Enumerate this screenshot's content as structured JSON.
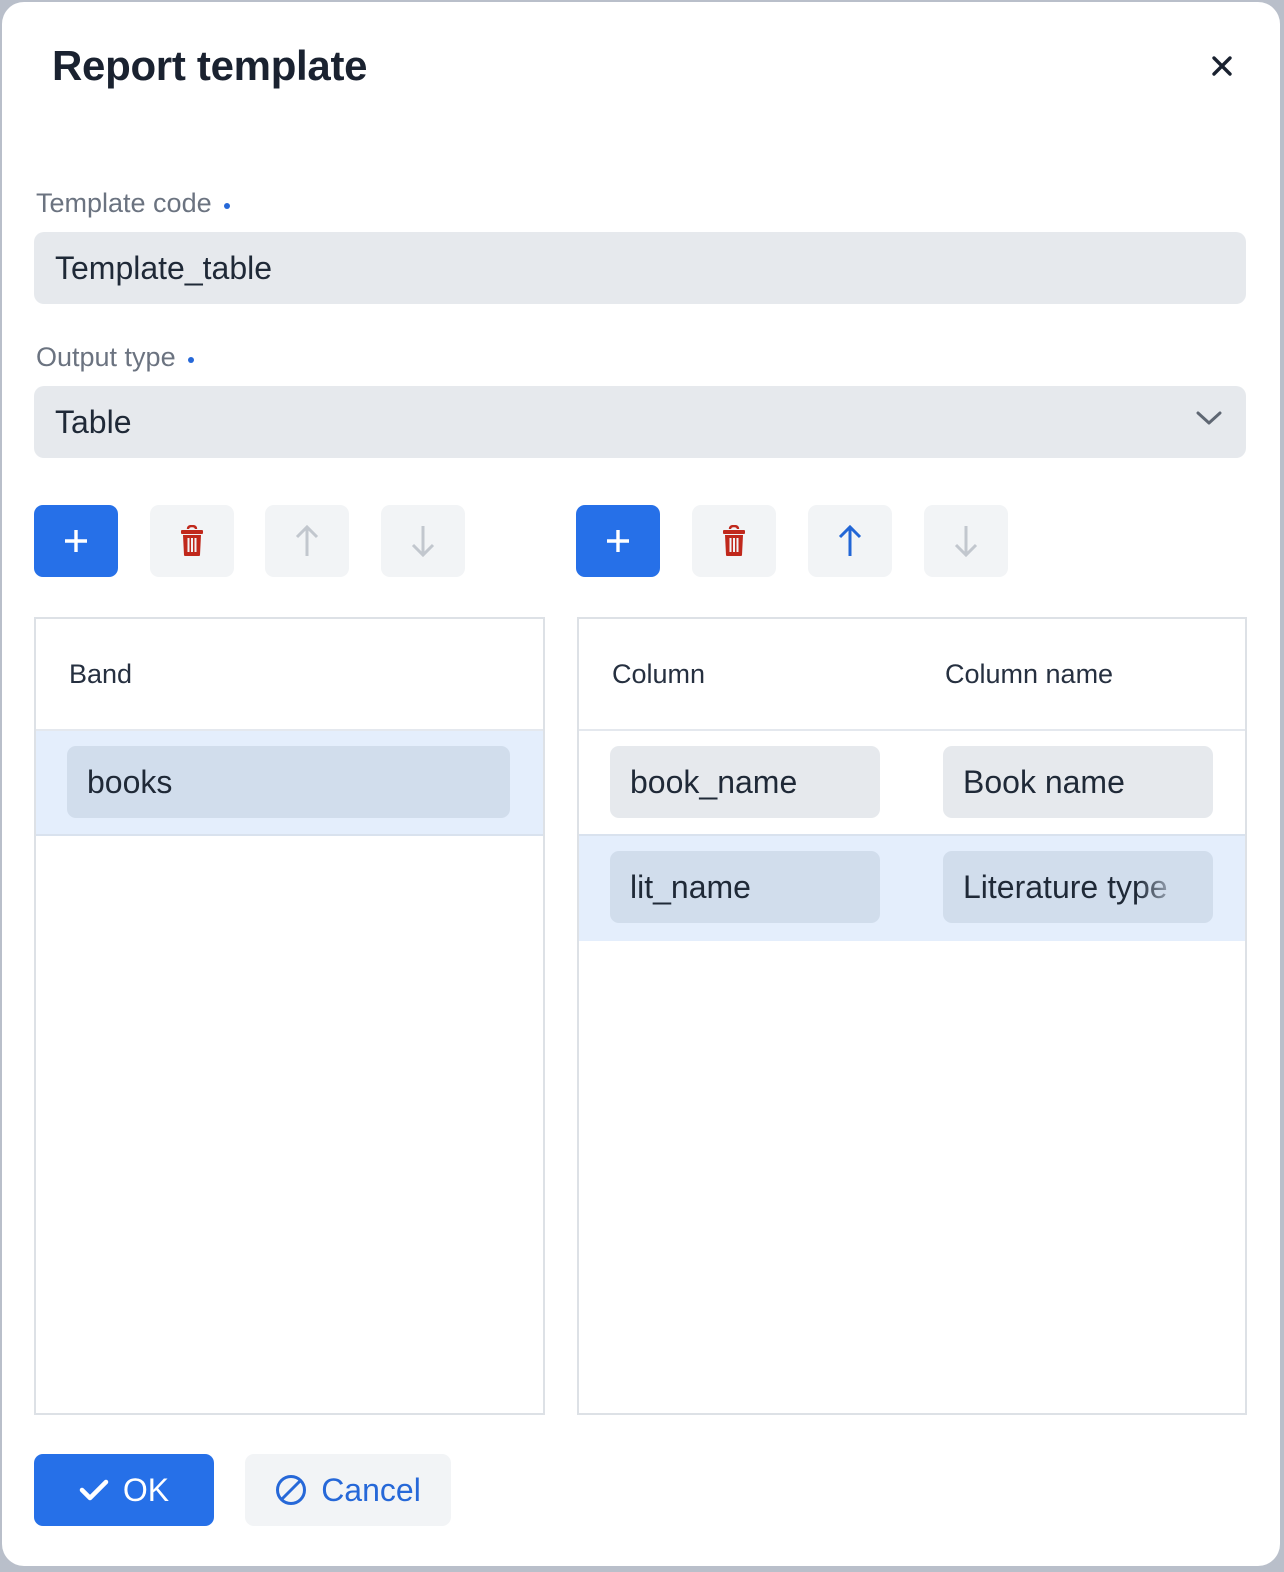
{
  "dialog": {
    "title": "Report template",
    "close_icon": "close-icon"
  },
  "form": {
    "template_code": {
      "label": "Template code",
      "required": true,
      "value": "Template_table"
    },
    "output_type": {
      "label": "Output type",
      "required": true,
      "value": "Table",
      "icon": "chevron-down-icon"
    }
  },
  "bands_toolbar": {
    "buttons": [
      {
        "name": "add",
        "icon": "plus-icon",
        "enabled": true
      },
      {
        "name": "remove",
        "icon": "trash-icon",
        "enabled": true
      },
      {
        "name": "move-up",
        "icon": "arrow-up-icon",
        "enabled": false
      },
      {
        "name": "move-down",
        "icon": "arrow-down-icon",
        "enabled": false
      }
    ]
  },
  "columns_toolbar": {
    "buttons": [
      {
        "name": "add",
        "icon": "plus-icon",
        "enabled": true
      },
      {
        "name": "remove",
        "icon": "trash-icon",
        "enabled": true
      },
      {
        "name": "move-up",
        "icon": "arrow-up-icon",
        "enabled": true
      },
      {
        "name": "move-down",
        "icon": "arrow-down-icon",
        "enabled": false
      }
    ]
  },
  "bands_table": {
    "headers": [
      "Band"
    ],
    "rows": [
      {
        "band": "books",
        "selected": true
      }
    ]
  },
  "columns_table": {
    "headers": [
      "Column",
      "Column name"
    ],
    "rows": [
      {
        "column": "book_name",
        "column_name": "Book name",
        "selected": false
      },
      {
        "column": "lit_name",
        "column_name": "Literature type",
        "selected": true
      }
    ]
  },
  "footer": {
    "ok_label": "OK",
    "ok_icon": "checkmark-icon",
    "cancel_label": "Cancel",
    "cancel_icon": "cancel-icon"
  },
  "colors": {
    "primary": "#2670e8",
    "danger": "#c0281c",
    "selected_row": "#e4eefc",
    "input_bg": "#e6e9ed",
    "disabled_icon": "#c2c7ce"
  }
}
